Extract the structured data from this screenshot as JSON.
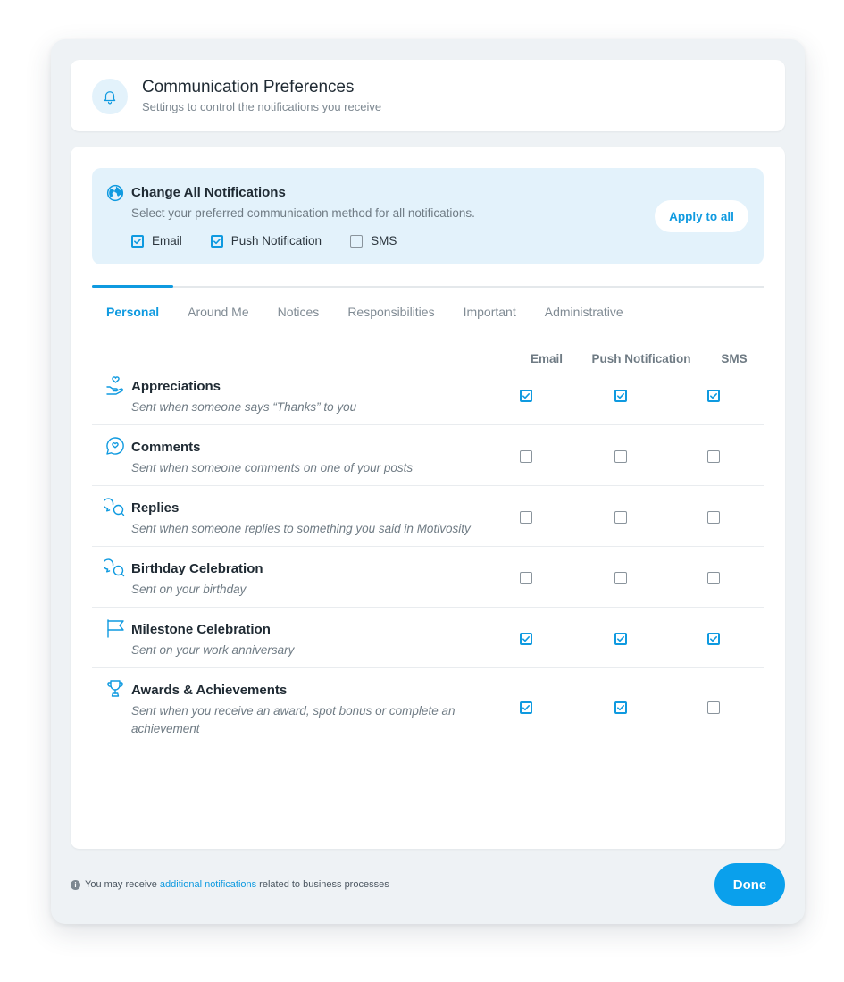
{
  "header": {
    "title": "Communication Preferences",
    "subtitle": "Settings to control the notifications you receive",
    "icon": "bell-icon"
  },
  "change_all": {
    "title": "Change All Notifications",
    "description": "Select your preferred communication method for all notifications.",
    "icon": "globe-icon",
    "options": [
      {
        "label": "Email",
        "checked": true
      },
      {
        "label": "Push Notification",
        "checked": true
      },
      {
        "label": "SMS",
        "checked": false
      }
    ],
    "apply_label": "Apply to all"
  },
  "tabs": [
    {
      "label": "Personal",
      "active": true
    },
    {
      "label": "Around Me",
      "active": false
    },
    {
      "label": "Notices",
      "active": false
    },
    {
      "label": "Responsibilities",
      "active": false
    },
    {
      "label": "Important",
      "active": false
    },
    {
      "label": "Administrative",
      "active": false
    }
  ],
  "columns": [
    "Email",
    "Push Notification",
    "SMS"
  ],
  "rows": [
    {
      "title": "Appreciations",
      "description": "Sent when someone says “Thanks” to you",
      "icon": "hand-heart-icon",
      "email": true,
      "push": true,
      "sms": true
    },
    {
      "title": "Comments",
      "description": "Sent when someone comments on one of your posts",
      "icon": "comment-heart-icon",
      "email": false,
      "push": false,
      "sms": false
    },
    {
      "title": "Replies",
      "description": "Sent when someone replies to something you said in Motivosity",
      "icon": "reply-bubbles-icon",
      "email": false,
      "push": false,
      "sms": false
    },
    {
      "title": "Birthday Celebration",
      "description": "Sent on your birthday",
      "icon": "reply-bubbles-icon",
      "email": false,
      "push": false,
      "sms": false
    },
    {
      "title": "Milestone Celebration",
      "description": "Sent on your work anniversary",
      "icon": "flag-icon",
      "email": true,
      "push": true,
      "sms": true
    },
    {
      "title": "Awards & Achievements",
      "description": "Sent when you receive an award, spot bonus or complete an achievement",
      "icon": "trophy-icon",
      "email": true,
      "push": true,
      "sms": false
    }
  ],
  "footer": {
    "text_before": "You may receive",
    "link": "additional notifications",
    "text_after": "related to business processes",
    "done_label": "Done"
  },
  "colors": {
    "accent": "#0f9ae0",
    "panel_bg": "#e3f2fb",
    "modal_bg": "#eef2f5"
  }
}
